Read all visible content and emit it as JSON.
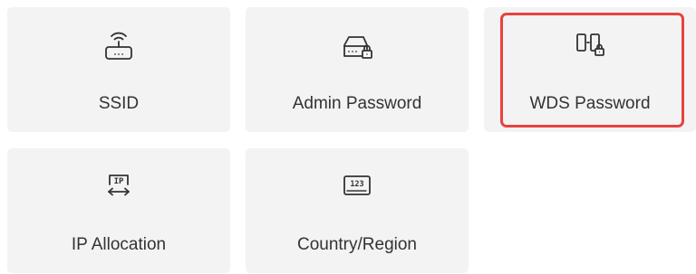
{
  "tiles": [
    {
      "label": "SSID",
      "icon": "router-wifi-icon",
      "selected": false
    },
    {
      "label": "Admin Password",
      "icon": "router-lock-icon",
      "selected": false
    },
    {
      "label": "WDS Password",
      "icon": "wds-lock-icon",
      "selected": true
    },
    {
      "label": "IP Allocation",
      "icon": "ip-allocation-icon",
      "selected": false
    },
    {
      "label": "Country/Region",
      "icon": "country-region-icon",
      "selected": false
    }
  ],
  "icon_text": {
    "ip": "IP",
    "region_code": "123"
  },
  "colors": {
    "tile_background": "#f3f3f3",
    "selected_border": "#e8423f",
    "label_text": "#333333",
    "icon_stroke": "#333333"
  }
}
